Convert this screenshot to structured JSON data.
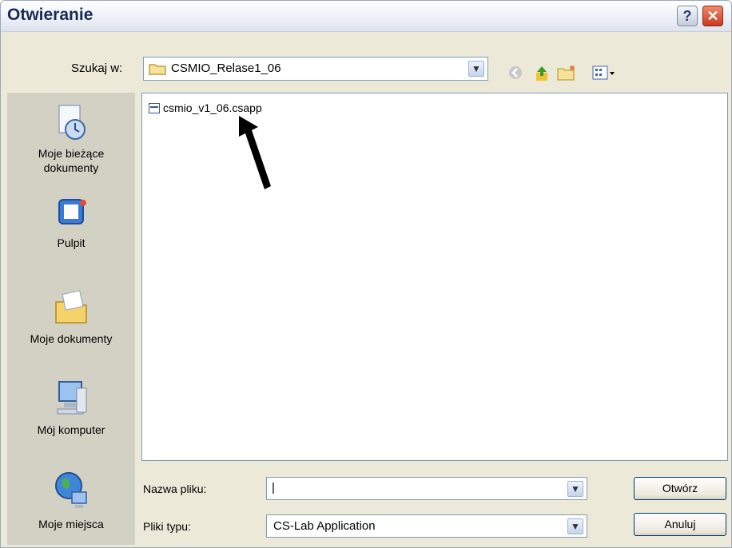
{
  "window": {
    "title": "Otwieranie",
    "help_label": "?",
    "close_label": "✕"
  },
  "toolbar": {
    "look_in_label": "Szukaj w:",
    "look_in_value": "CSMIO_Relase1_06"
  },
  "places": [
    {
      "label_line1": "Moje bieżące",
      "label_line2": "dokumenty",
      "icon": "recent-documents-icon"
    },
    {
      "label_line1": "Pulpit",
      "label_line2": "",
      "icon": "desktop-icon"
    },
    {
      "label_line1": "Moje dokumenty",
      "label_line2": "",
      "icon": "my-documents-icon"
    },
    {
      "label_line1": "Mój komputer",
      "label_line2": "",
      "icon": "my-computer-icon"
    },
    {
      "label_line1": "Moje miejsca",
      "label_line2": "",
      "icon": "network-places-icon"
    }
  ],
  "files": [
    {
      "name": "csmio_v1_06.csapp",
      "icon": "csapp-file-icon"
    }
  ],
  "form": {
    "filename_label": "Nazwa pliku:",
    "filename_value": "|",
    "filetype_label": "Pliki typu:",
    "filetype_value": "CS-Lab Application"
  },
  "buttons": {
    "open_label": "Otwórz",
    "cancel_label": "Anuluj"
  }
}
